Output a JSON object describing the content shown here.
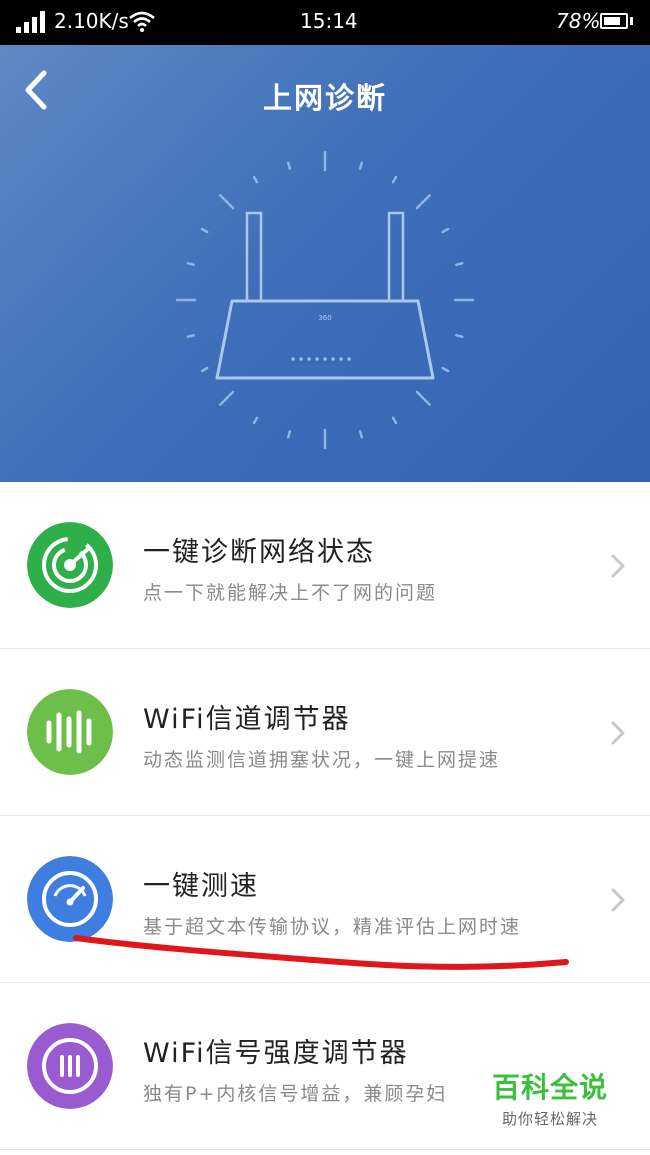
{
  "status_bar": {
    "speed": "2.10K/s",
    "time": "15:14",
    "battery": "78%",
    "battery_level": 0.78
  },
  "header": {
    "title": "上网诊断",
    "back_icon": "chevron-left-icon",
    "illustration": "router-icon",
    "router_brand": "360"
  },
  "items": [
    {
      "title": "一键诊断网络状态",
      "subtitle": "点一下就能解决上不了网的问题",
      "icon": "radar-icon",
      "color": "#2eaf4a"
    },
    {
      "title": "WiFi信道调节器",
      "subtitle": "动态监测信道拥塞状况，一键上网提速",
      "icon": "signal-bars-icon",
      "color": "#6cc04a"
    },
    {
      "title": "一键测速",
      "subtitle": "基于超文本传输协议，精准评估上网时速",
      "icon": "speedometer-icon",
      "color": "#3f7ee0"
    },
    {
      "title": "WiFi信号强度调节器",
      "subtitle": "独有P+内核信号增益，兼顾孕妇",
      "icon": "signal-strength-icon",
      "color": "#9b5bd0"
    }
  ],
  "watermark": {
    "main": "百科全说",
    "sub": "助你轻松解决"
  },
  "colors": {
    "header_blue": "#3463b2",
    "annotation_red": "#e0161b"
  }
}
